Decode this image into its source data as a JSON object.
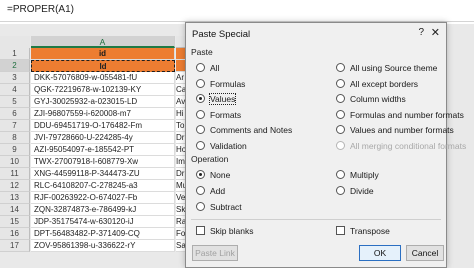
{
  "formula_bar": {
    "formula": "=PROPER(A1)"
  },
  "sheet": {
    "columns": [
      {
        "label": "A"
      }
    ],
    "rows": [
      {
        "num": "1",
        "a": "id",
        "b": ""
      },
      {
        "num": "2",
        "a": "Id",
        "b": ""
      },
      {
        "num": "3",
        "a": "DKK-57076809-w-055481-fU",
        "b": "Ar"
      },
      {
        "num": "4",
        "a": "QGK-72219678-w-102139-KY",
        "b": "Ca"
      },
      {
        "num": "5",
        "a": "GYJ-30025932-a-023015-LD",
        "b": "Av"
      },
      {
        "num": "6",
        "a": "ZJI-96807559-i-620008-m7",
        "b": "Hi"
      },
      {
        "num": "7",
        "a": "DDU-69451719-O-176482-Fm",
        "b": "To"
      },
      {
        "num": "8",
        "a": "JVI-79728660-U-224285-4y",
        "b": "Dr"
      },
      {
        "num": "9",
        "a": "AZI-95054097-e-185542-PT",
        "b": "Ho"
      },
      {
        "num": "10",
        "a": "TWX-27007918-I-608779-Xw",
        "b": "Im"
      },
      {
        "num": "11",
        "a": "XNG-44599118-P-344473-ZU",
        "b": "Dr"
      },
      {
        "num": "12",
        "a": "RLC-64108207-C-278245-a3",
        "b": "Mu"
      },
      {
        "num": "13",
        "a": "RJF-00263922-O-674027-Fb",
        "b": "Ve"
      },
      {
        "num": "14",
        "a": "ZQN-32874873-e-786499-kJ",
        "b": "Sk"
      },
      {
        "num": "15",
        "a": "JDP-35175474-w-630120-iJ",
        "b": "Ra"
      },
      {
        "num": "16",
        "a": "DPT-56483482-P-371409-CQ",
        "b": "Fo"
      },
      {
        "num": "17",
        "a": "ZOV-95861398-u-336622-rY",
        "b": "Sa"
      }
    ]
  },
  "dialog": {
    "title": "Paste Special",
    "help_glyph": "?",
    "close_glyph": "✕",
    "paste_section": "Paste",
    "paste_left": [
      {
        "label": "All",
        "checked": false,
        "disabled": false
      },
      {
        "label": "Formulas",
        "checked": false,
        "disabled": false
      },
      {
        "label": "Values",
        "checked": true,
        "disabled": false
      },
      {
        "label": "Formats",
        "checked": false,
        "disabled": false
      },
      {
        "label": "Comments and Notes",
        "checked": false,
        "disabled": false
      },
      {
        "label": "Validation",
        "checked": false,
        "disabled": false
      }
    ],
    "paste_right": [
      {
        "label": "All using Source theme",
        "checked": false,
        "disabled": false
      },
      {
        "label": "All except borders",
        "checked": false,
        "disabled": false
      },
      {
        "label": "Column widths",
        "checked": false,
        "disabled": false
      },
      {
        "label": "Formulas and number formats",
        "checked": false,
        "disabled": false
      },
      {
        "label": "Values and number formats",
        "checked": false,
        "disabled": false
      },
      {
        "label": "All merging conditional formats",
        "checked": false,
        "disabled": true
      }
    ],
    "operation_section": "Operation",
    "operation_left": [
      {
        "label": "None",
        "checked": true
      },
      {
        "label": "Add",
        "checked": false
      },
      {
        "label": "Subtract",
        "checked": false
      }
    ],
    "operation_right": [
      {
        "label": "Multiply",
        "checked": false
      },
      {
        "label": "Divide",
        "checked": false
      }
    ],
    "skip_blanks": "Skip blanks",
    "transpose": "Transpose",
    "paste_link": "Paste Link",
    "ok": "OK",
    "cancel": "Cancel"
  },
  "colors": {
    "header_fill": "#ed7d31",
    "accent": "#1f7a45"
  }
}
